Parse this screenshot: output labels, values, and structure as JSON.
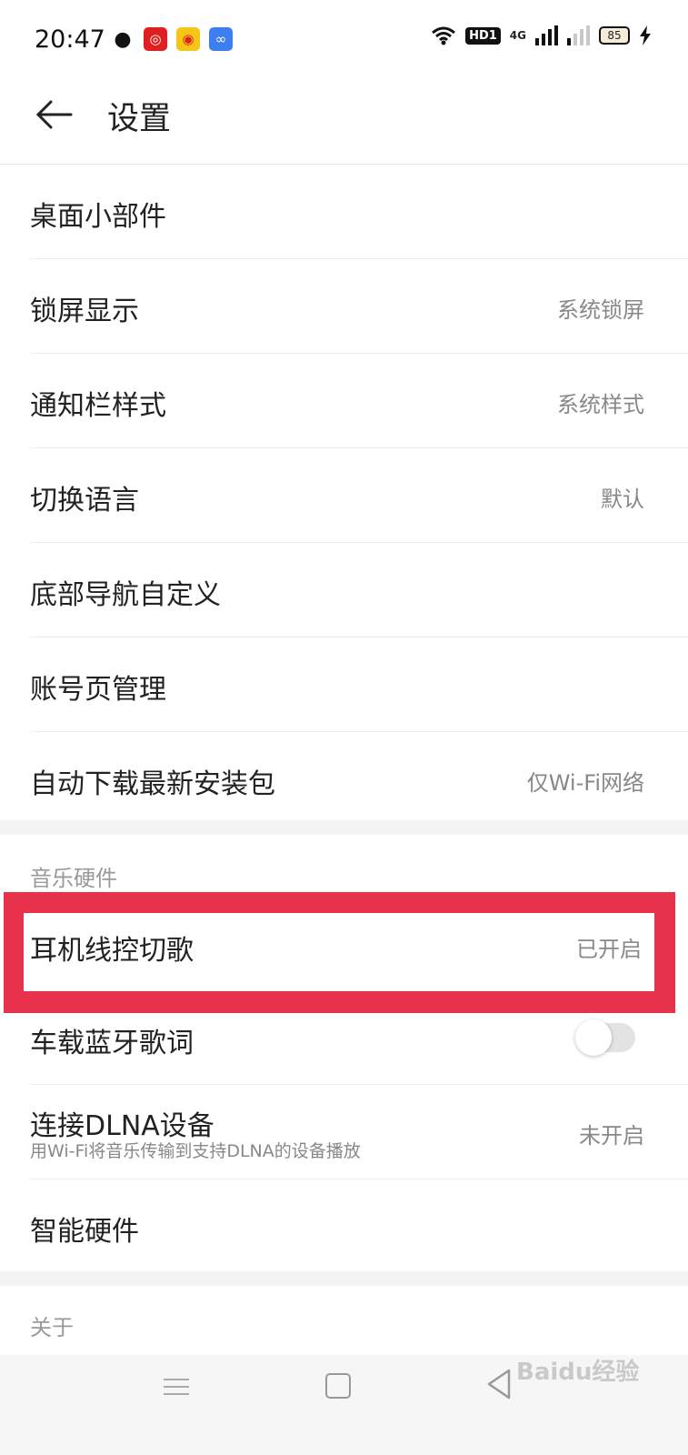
{
  "status_bar": {
    "time": "20:47",
    "hd_label": "HD1",
    "network": "4G",
    "battery": "85"
  },
  "header": {
    "title": "设置"
  },
  "groups": [
    {
      "items": [
        {
          "label": "桌面小部件",
          "value": ""
        },
        {
          "label": "锁屏显示",
          "value": "系统锁屏"
        },
        {
          "label": "通知栏样式",
          "value": "系统样式"
        },
        {
          "label": "切换语言",
          "value": "默认"
        },
        {
          "label": "底部导航自定义",
          "value": ""
        },
        {
          "label": "账号页管理",
          "value": ""
        },
        {
          "label": "自动下载最新安装包",
          "value": "仅Wi-Fi网络"
        }
      ]
    },
    {
      "title": "音乐硬件",
      "items": [
        {
          "label": "耳机线控切歌",
          "value": "已开启"
        },
        {
          "label": "车载蓝牙歌词",
          "toggle": false
        },
        {
          "label": "连接DLNA设备",
          "sub": "用Wi-Fi将音乐传输到支持DLNA的设备播放",
          "value": "未开启"
        },
        {
          "label": "智能硬件",
          "value": ""
        }
      ]
    },
    {
      "title": "关于"
    }
  ],
  "watermark": "Baidu经验",
  "colors": {
    "highlight": "#e8314b",
    "background": "#f3f3f3"
  }
}
